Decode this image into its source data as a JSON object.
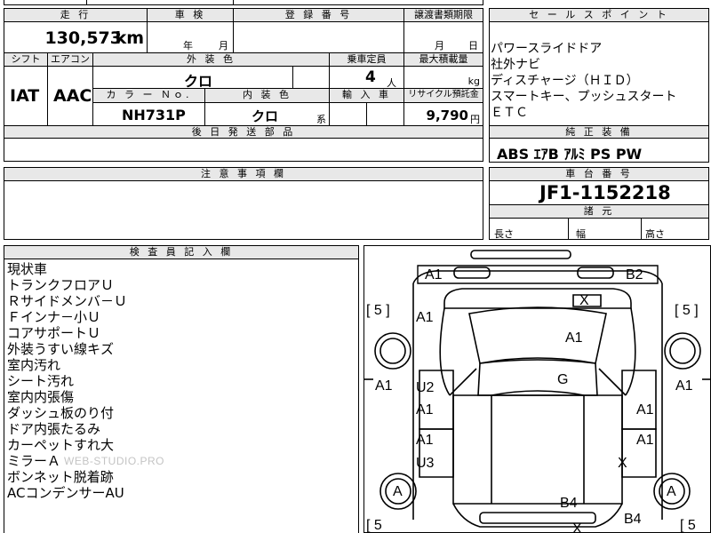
{
  "top": {
    "mileage_header": "走 行",
    "shaken_header": "車 検",
    "reg_header": "登 録 番 号",
    "transfer_header": "譲渡書類期限",
    "mileage_value": "130,573",
    "mileage_unit": "km",
    "year_unit": "年",
    "month_unit": "月",
    "transfer_month": "月",
    "transfer_day": "日"
  },
  "row2": {
    "shift_header": "シフト",
    "ac_header": "エアコン",
    "exterior_header": "外 装 色",
    "capacity_header": "乗車定員",
    "loadcap_header": "最大積載量",
    "shift_value": "IAT",
    "ac_value": "AAC",
    "exterior_value": "クロ",
    "capacity_value": "4",
    "capacity_unit": "人",
    "loadcap_unit": "kg",
    "colorno_header": "カ ラ ー Ｎｏ.",
    "interior_header": "内 装 色",
    "import_header": "輸 入 車",
    "recycle_header": "リサイクル預託金",
    "colorno_value": "NH731P",
    "interior_value": "クロ",
    "interior_suffix": "系",
    "recycle_value": "9,790",
    "recycle_unit": "円",
    "later_parts_header": "後 日 発 送 部 品"
  },
  "sales": {
    "header": "セ ー ル ス ポ イ ン ト",
    "lines": [
      "パワースライドドア",
      "社外ナビ",
      "ディスチャージ（ＨＩＤ）",
      "スマートキー、プッシュスタート",
      "ＥＴＣ"
    ]
  },
  "equipment": {
    "header": "純 正 装 備",
    "value": "ABS ｴｱB ｱﾙﾐ PS PW"
  },
  "caution": {
    "header": "注 意 事 項 欄"
  },
  "chassis": {
    "header": "車 台 番 号",
    "value": "JF1-1152218",
    "dims_header": "諸 元",
    "length": "長さ",
    "width": "幅",
    "height": "高さ"
  },
  "inspector": {
    "header": "検 査 員 記 入 欄",
    "lines": [
      "現状車",
      "トランクフロアＵ",
      "Ｒサイドメンバ－Ｕ",
      "Ｆインナ－小Ｕ",
      "コアサポートＵ",
      "外装うすい線キズ",
      "室内汚れ",
      "シート汚れ",
      "室内内張傷",
      "ダッシュ板のり付",
      "ドア内張たるみ",
      "カーペットすれ大",
      "ミラーＡ",
      "ボンネット脱着跡",
      "ACコンデンサーAU"
    ],
    "watermark": "WEB-STUDIO.PRO"
  },
  "diagram": {
    "tire_left_top": "[ 5 ]",
    "tire_right_top": "[ 5 ]",
    "tire_left_bottom": "[ 5",
    "tire_right_bottom": "[ 5",
    "marks": {
      "front_bumper_left": "A1",
      "front_bumper_right": "B2",
      "windshield": "X",
      "front_fender_left": "A1",
      "hood": "A1",
      "roof": "G",
      "left_side": "A1",
      "right_side": "A1",
      "front_door_left_1": "U2",
      "front_door_left_2": "A1",
      "front_door_right": "A1",
      "rear_door_left_1": "A1",
      "rear_door_left_2": "U3",
      "rear_door_right_1": "A1",
      "rear_door_right_2": "X",
      "wheel_left": "A",
      "wheel_right": "A",
      "trunk": "B4",
      "rear_bumper_right": "B4",
      "rear_window": "X"
    }
  }
}
